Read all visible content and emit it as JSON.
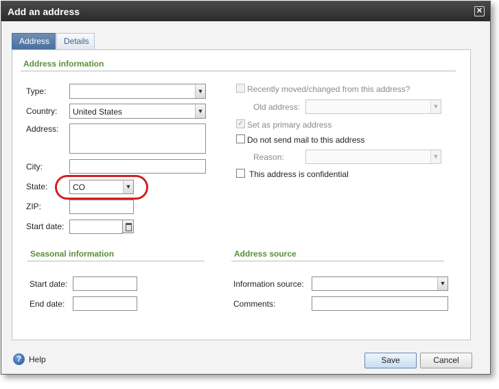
{
  "dialog": {
    "title": "Add an address",
    "close_glyph": "✕"
  },
  "tabs": [
    {
      "label": "Address",
      "active": true
    },
    {
      "label": "Details",
      "active": false
    }
  ],
  "address_info": {
    "section_title": "Address information",
    "type_label": "Type:",
    "type_value": "",
    "country_label": "Country:",
    "country_value": "United States",
    "address_label": "Address:",
    "address_value": "",
    "city_label": "City:",
    "city_value": "",
    "state_label": "State:",
    "state_value": "CO",
    "zip_label": "ZIP:",
    "zip_value": "",
    "start_date_label": "Start date:",
    "start_date_value": ""
  },
  "options": {
    "recently_moved_label": "Recently moved/changed from this address?",
    "recently_moved_checked": false,
    "old_address_label": "Old address:",
    "primary_label": "Set as primary address",
    "primary_checked": true,
    "no_mail_label": "Do not send mail to this address",
    "no_mail_checked": false,
    "reason_label": "Reason:",
    "confidential_label": "This address is confidential",
    "confidential_checked": false
  },
  "seasonal": {
    "section_title": "Seasonal information",
    "start_date_label": "Start date:",
    "end_date_label": "End date:"
  },
  "source": {
    "section_title": "Address source",
    "info_source_label": "Information source:",
    "comments_label": "Comments:"
  },
  "footer": {
    "help_label": "Help",
    "save_label": "Save",
    "cancel_label": "Cancel"
  },
  "icons": {
    "dropdown": "▼",
    "checkmark": "✓",
    "help": "?"
  },
  "colors": {
    "section_title": "#5b8e3a",
    "active_tab": "#4a70a0",
    "highlight": "#d21f1f",
    "titlebar": "#2f2f2f"
  }
}
